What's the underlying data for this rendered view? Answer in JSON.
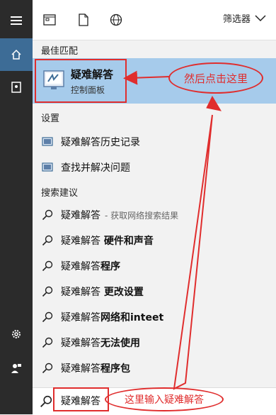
{
  "topbar": {
    "filter_label": "筛选器"
  },
  "sections": {
    "best_match": "最佳匹配",
    "settings": "设置",
    "search_suggestions": "搜索建议"
  },
  "best_match_item": {
    "title": "疑难解答",
    "subtitle": "控制面板"
  },
  "settings_items": [
    "疑难解答历史记录",
    "查找并解决问题"
  ],
  "suggestions": [
    {
      "bold": "疑难解答",
      "normal": "",
      "extra": "- 获取网络搜索结果"
    },
    {
      "bold": "疑难解答",
      "normal": " 硬件和声音",
      "extra": ""
    },
    {
      "bold": "疑难解答",
      "normal": "程序",
      "extra": ""
    },
    {
      "bold": "疑难解答",
      "normal": " 更改设置",
      "extra": ""
    },
    {
      "bold": "疑难解答",
      "normal": "网络和inteet",
      "extra": ""
    },
    {
      "bold": "疑难解答",
      "normal": "无法使用",
      "extra": ""
    },
    {
      "bold": "疑难解答",
      "normal": "程序包",
      "extra": ""
    }
  ],
  "search": {
    "value": "疑难解答"
  },
  "annotations": {
    "click_here": "然后点击这里",
    "type_here": "这里输入疑难解答"
  },
  "colors": {
    "accent": "#3d6c96",
    "highlight": "#a6cbeb",
    "annotation": "#e02d2d"
  }
}
